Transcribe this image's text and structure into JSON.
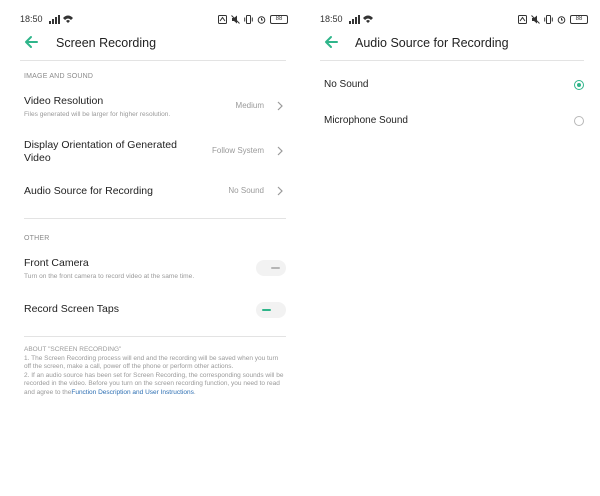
{
  "colors": {
    "accent": "#2fb58a",
    "link": "#2d6fb3",
    "secondary_text": "#9a9a9a",
    "divider": "#e3e3e3"
  },
  "left": {
    "status": {
      "time": "18:50",
      "battery": "88",
      "icons": [
        "signal-icon",
        "wifi-icon",
        "nfc-icon",
        "mute-icon",
        "vibrate-icon",
        "alarm-icon",
        "battery-icon"
      ]
    },
    "title": "Screen Recording",
    "sections": {
      "image_sound": "IMAGE AND SOUND",
      "other": "OTHER"
    },
    "video_resolution": {
      "title": "Video Resolution",
      "subtitle": "Files generated will be larger for higher resolution.",
      "value": "Medium"
    },
    "display_orientation": {
      "title": "Display Orientation of Generated Video",
      "value": "Follow System"
    },
    "audio_source": {
      "title": "Audio Source for Recording",
      "value": "No Sound"
    },
    "front_camera": {
      "title": "Front Camera",
      "subtitle": "Turn on the front camera to record video at the same time.",
      "enabled": false
    },
    "record_taps": {
      "title": "Record Screen Taps",
      "enabled": true
    },
    "about": {
      "heading": "ABOUT \"SCREEN RECORDING\"",
      "item1": "1. The Screen Recording process will end and the recording will be saved when you turn off the screen, make a call, power off the phone or perform other actions.",
      "item2": "2. If an audio source has been set for Screen Recording, the corresponding sounds will be recorded in the video. Before you turn on the screen recording function, you need to read and agree to the",
      "link": "Function Description and User Instructions",
      "end": "."
    }
  },
  "right": {
    "status": {
      "time": "18:50",
      "battery": "88",
      "icons": [
        "signal-icon",
        "wifi-icon",
        "nfc-icon",
        "mute-icon",
        "vibrate-icon",
        "alarm-icon",
        "battery-icon"
      ]
    },
    "title": "Audio Source for Recording",
    "options": [
      {
        "label": "No Sound",
        "selected": true
      },
      {
        "label": "Microphone Sound",
        "selected": false
      }
    ]
  }
}
